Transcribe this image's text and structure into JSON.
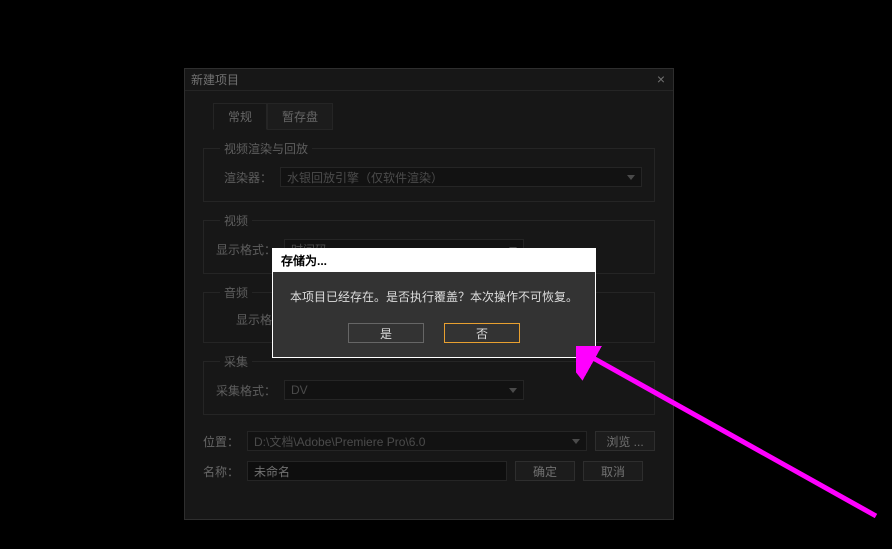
{
  "mainDialog": {
    "title": "新建项目",
    "tabs": {
      "general": "常规",
      "scratch": "暂存盘"
    },
    "groups": {
      "videoRender": {
        "legend": "视频渲染与回放",
        "rendererLabel": "渲染器：",
        "rendererValue": "水银回放引擎（仅软件渲染）"
      },
      "video": {
        "legend": "视频",
        "formatLabel": "显示格式：",
        "formatValue": "时间码"
      },
      "audio": {
        "legend": "音频",
        "formatLabel": "显示格"
      },
      "capture": {
        "legend": "采集",
        "formatLabel": "采集格式：",
        "formatValue": "DV"
      }
    },
    "locationLabel": "位置：",
    "locationValue": "D:\\文档\\Adobe\\Premiere Pro\\6.0",
    "browseBtn": "浏览 ...",
    "nameLabel": "名称：",
    "nameValue": "未命名",
    "okBtn": "确定",
    "cancelBtn": "取消"
  },
  "modal": {
    "title": "存储为...",
    "message": "本项目已经存在。是否执行覆盖？本次操作不可恢复。",
    "yes": "是",
    "no": "否"
  }
}
